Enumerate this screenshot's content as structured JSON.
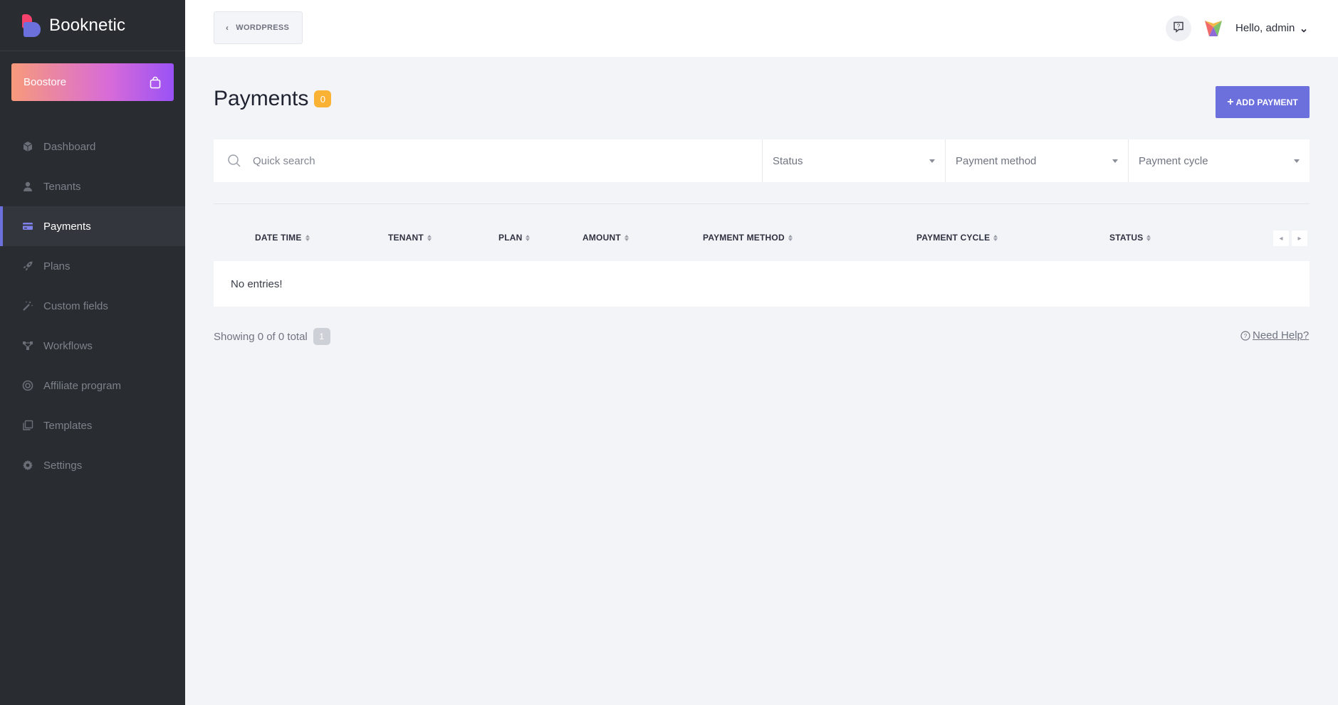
{
  "brand": {
    "name": "Booknetic"
  },
  "boostore": {
    "label": "Boostore"
  },
  "nav": {
    "items": [
      {
        "label": "Dashboard",
        "icon": "cube-icon",
        "active": false
      },
      {
        "label": "Tenants",
        "icon": "user-icon",
        "active": false
      },
      {
        "label": "Payments",
        "icon": "credit-card-icon",
        "active": true
      },
      {
        "label": "Plans",
        "icon": "rocket-icon",
        "active": false
      },
      {
        "label": "Custom fields",
        "icon": "magic-wand-icon",
        "active": false
      },
      {
        "label": "Workflows",
        "icon": "workflow-icon",
        "active": false
      },
      {
        "label": "Affiliate program",
        "icon": "target-icon",
        "active": false
      },
      {
        "label": "Templates",
        "icon": "copy-icon",
        "active": false
      },
      {
        "label": "Settings",
        "icon": "gear-icon",
        "active": false
      }
    ]
  },
  "topbar": {
    "wordpress_label": "WORDPRESS",
    "greeting": "Hello, admin"
  },
  "page": {
    "title": "Payments",
    "count": "0",
    "add_label": "ADD PAYMENT"
  },
  "filters": {
    "search_placeholder": "Quick search",
    "status": "Status",
    "payment_method": "Payment method",
    "payment_cycle": "Payment cycle"
  },
  "table": {
    "columns": [
      "DATE TIME",
      "TENANT",
      "PLAN",
      "AMOUNT",
      "PAYMENT METHOD",
      "PAYMENT CYCLE",
      "STATUS"
    ],
    "empty_text": "No entries!"
  },
  "footer": {
    "showing": "Showing 0 of 0 total",
    "page": "1",
    "help": "Need Help?"
  },
  "colors": {
    "sidebar_bg": "#292d32",
    "accent": "#6c70dc",
    "badge": "#f9b234",
    "page_bg": "#f3f4f8"
  }
}
